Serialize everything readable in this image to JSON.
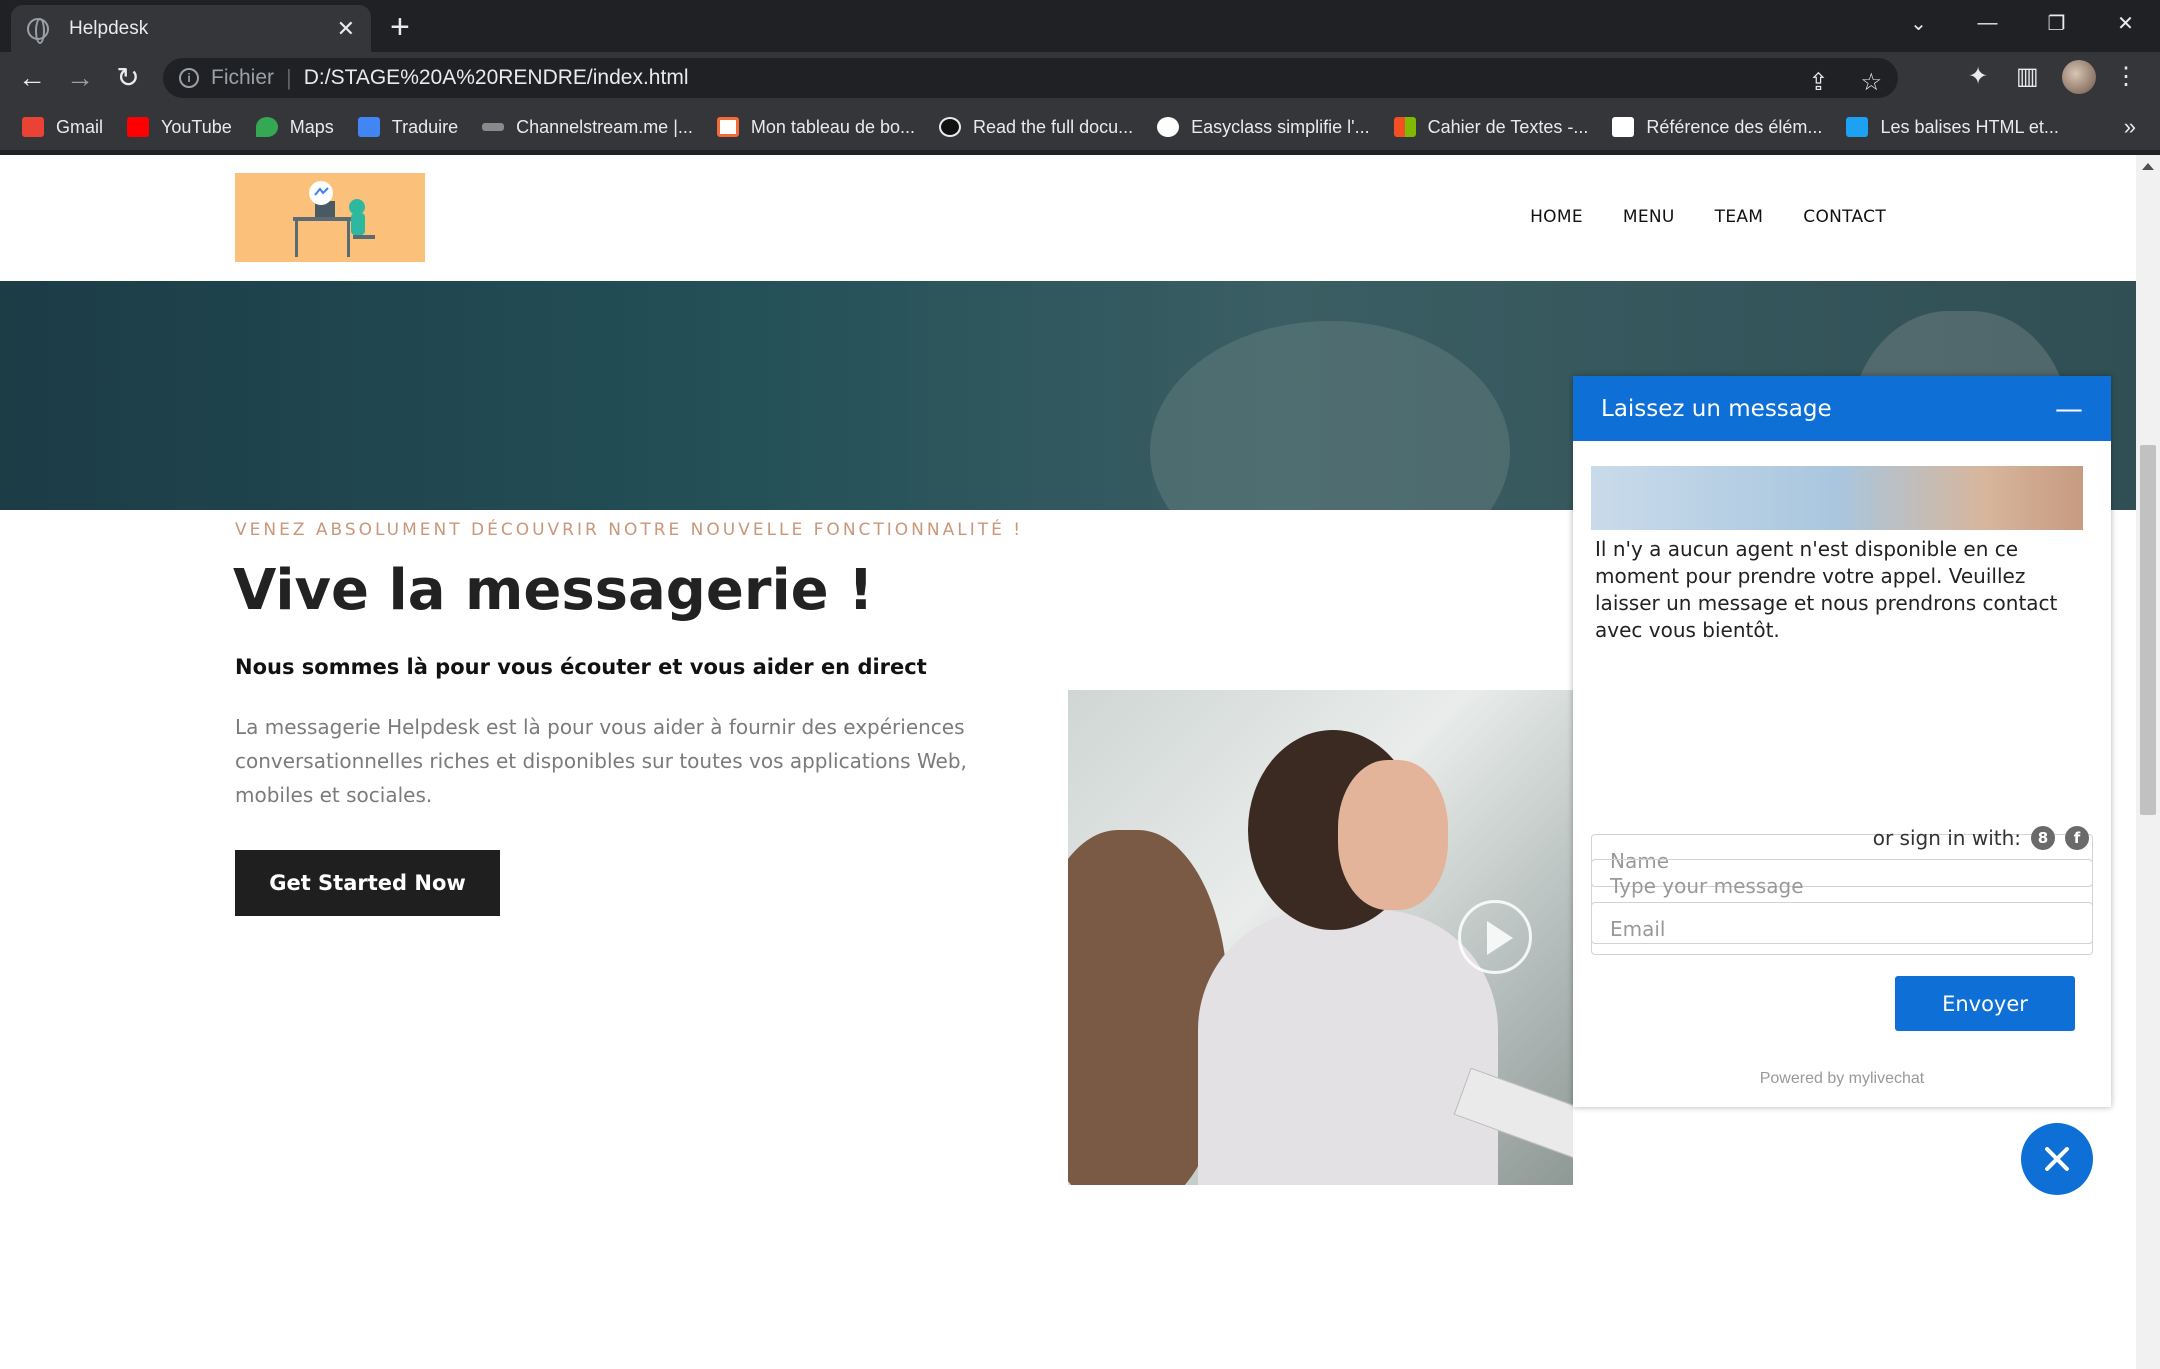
{
  "browser": {
    "tab_title": "Helpdesk",
    "tab_close": "✕",
    "new_tab": "+",
    "url_scheme": "Fichier",
    "url": "D:/STAGE%20A%20RENDRE/index.html",
    "window_controls": [
      "⌄",
      "—",
      "❐",
      "✕"
    ],
    "bookmarks": [
      {
        "label": "Gmail",
        "color": "#ea4335"
      },
      {
        "label": "YouTube",
        "color": "#ff0000"
      },
      {
        "label": "Maps",
        "color": "#34a853"
      },
      {
        "label": "Traduire",
        "color": "#4285f4"
      },
      {
        "label": "Channelstream.me |...",
        "color": "#8a8a8a"
      },
      {
        "label": "Mon tableau de bo...",
        "color": "#ffffff"
      },
      {
        "label": "Read the full docu...",
        "color": "#222222"
      },
      {
        "label": "Easyclass simplifie l'...",
        "color": "#ffffff"
      },
      {
        "label": "Cahier de Textes -...",
        "color": "#f25022"
      },
      {
        "label": "Référence des élém...",
        "color": "#ffffff"
      },
      {
        "label": "Les balises HTML et...",
        "color": "#1da1f2"
      }
    ],
    "bookmarks_more": "»"
  },
  "site": {
    "nav": [
      "HOME",
      "MENU",
      "TEAM",
      "CONTACT"
    ],
    "eyebrow": "VENEZ ABSOLUMENT DÉCOUVRIR NOTRE NOUVELLE FONCTIONNALITÉ !",
    "headline": "Vive la messagerie !",
    "subhead": "Nous sommes là pour vous écouter et vous aider en direct",
    "body": "La messagerie Helpdesk est là pour vous aider à fournir des expériences conversationnelles riches et disponibles sur toutes vos applications Web, mobiles et sociales.",
    "cta": "Get Started Now"
  },
  "chat": {
    "title": "Laissez un message",
    "minimize": "—",
    "message": "Il n'y a aucun agent n'est disponible en ce moment pour prendre votre appel. Veuillez laisser un message et nous prendrons contact avec vous bientôt.",
    "name_placeholder": "Name",
    "email_placeholder": "Email",
    "signin_label": "or sign in with:",
    "google_icon": "8",
    "facebook_icon": "f",
    "message_placeholder": "Type your message",
    "send": "Envoyer",
    "powered": "Powered by mylivechat",
    "accent": "#0e6fd6"
  }
}
